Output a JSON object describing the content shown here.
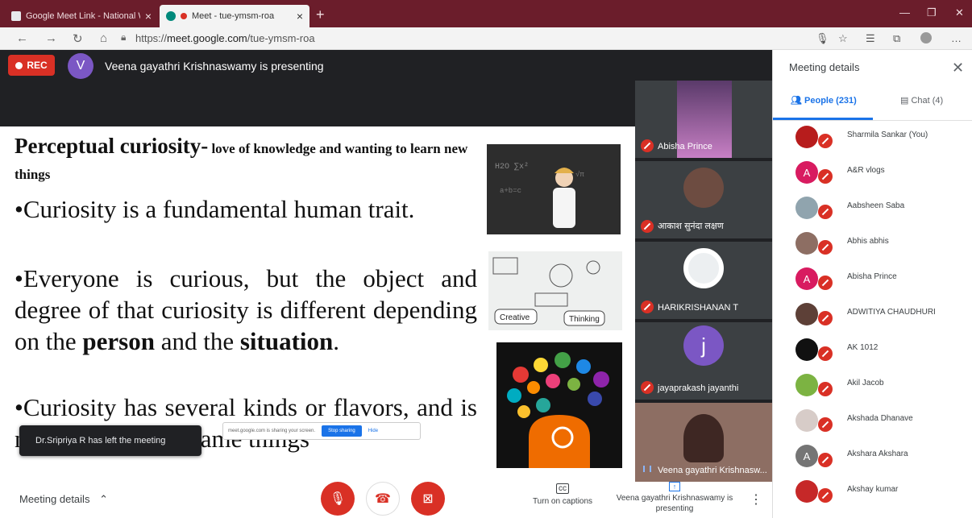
{
  "browser": {
    "tabs": [
      {
        "label": "Google Meet Link - National W...",
        "active": false
      },
      {
        "label": "Meet - tue-ymsm-roa",
        "active": true
      }
    ],
    "url_prefix": "https://",
    "url_host": "meet.google.com",
    "url_path": "/tue-ymsm-roa"
  },
  "meet": {
    "rec_label": "REC",
    "presenter_initial": "V",
    "presenting_banner": "Veena gayathri Krishnaswamy is presenting"
  },
  "slide": {
    "title": "Perceptual curiosity-",
    "title_sub": " love of knowledge and wanting to learn new things",
    "bullets": [
      "•Curiosity is a fundamental human trait.",
      "•Everyone is curious, but the object and degree of that curiosity is different depending on the ",
      "•Curiosity has several kinds or flavors, and is not driven by the same things"
    ],
    "bold_person": "person",
    "bullet2_mid": " and the ",
    "bold_situation": "situation",
    "bullet2_end": ".",
    "img2_labels": [
      "Creative",
      "Thinking"
    ]
  },
  "tiles": [
    {
      "name": "Abisha Prince"
    },
    {
      "name": "आकाश सुनंदा लक्षण"
    },
    {
      "name": "HARIKRISHANAN T"
    },
    {
      "name": "jayaprakash jayanthi",
      "initial": "j"
    },
    {
      "name": "Veena gayathri Krishnasw..."
    }
  ],
  "toast": {
    "text": "Dr.Sripriya R has left the meeting"
  },
  "share_bar": {
    "text": "meet.google.com is sharing your screen.",
    "stop": "Stop sharing",
    "hide": "Hide"
  },
  "bottom": {
    "meeting_details": "Meeting details",
    "captions_label": "Turn on captions",
    "presenting_label": "Veena gayathri Krishnaswamy is presenting"
  },
  "panel": {
    "title": "Meeting details",
    "people_tab": "People (231)",
    "chat_tab": "Chat (4)",
    "people": [
      {
        "name": "Sharmila Sankar (You)",
        "color": "#b71c1c",
        "initial": ""
      },
      {
        "name": "A&R vlogs",
        "color": "#d81b60",
        "initial": "A"
      },
      {
        "name": "Aabsheen Saba",
        "color": "#90a4ae",
        "initial": ""
      },
      {
        "name": "Abhis abhis",
        "color": "#8d6e63",
        "initial": ""
      },
      {
        "name": "Abisha Prince",
        "color": "#d81b60",
        "initial": "A"
      },
      {
        "name": "ADWITIYA CHAUDHURI",
        "color": "#5d4037",
        "initial": ""
      },
      {
        "name": "AK 1012",
        "color": "#111111",
        "initial": ""
      },
      {
        "name": "Akil Jacob",
        "color": "#7cb342",
        "initial": ""
      },
      {
        "name": "Akshada Dhanave",
        "color": "#d7ccc8",
        "initial": ""
      },
      {
        "name": "Akshara Akshara",
        "color": "#757575",
        "initial": "A"
      },
      {
        "name": "Akshay kumar",
        "color": "#c62828",
        "initial": ""
      }
    ]
  }
}
